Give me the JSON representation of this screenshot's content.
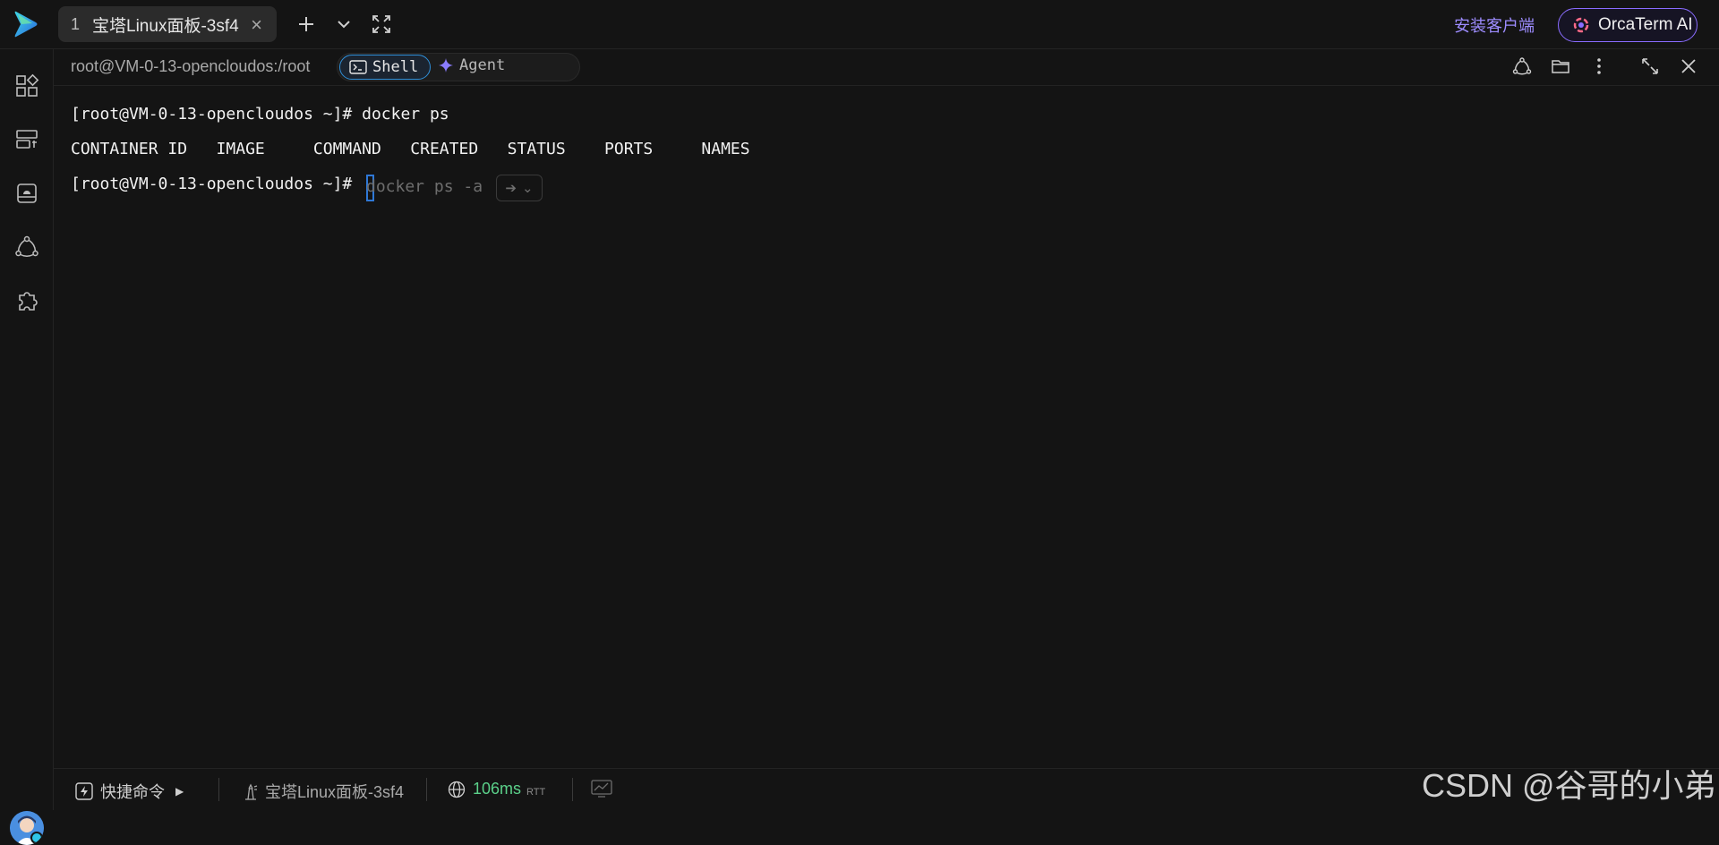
{
  "tabs": [
    {
      "index": "1",
      "title": "宝塔Linux面板-3sf4"
    }
  ],
  "header": {
    "install_label": "安装客户端",
    "ai_label": "OrcaTerm AI"
  },
  "session": {
    "path": "root@VM-0-13-opencloudos:/root",
    "mode_shell": "Shell",
    "mode_agent": "Agent"
  },
  "terminal": {
    "lines": [
      "[root@VM-0-13-opencloudos ~]# docker ps",
      "CONTAINER ID   IMAGE     COMMAND   CREATED   STATUS    PORTS     NAMES",
      "[root@VM-0-13-opencloudos ~]# "
    ],
    "suggestion": "docker ps -a",
    "accept_symbol": "➔",
    "accept_caret": "⌄"
  },
  "statusbar": {
    "quick_commands": "快捷命令",
    "server_name": "宝塔Linux面板-3sf4",
    "rtt_value": "106ms",
    "rtt_unit": "RTT"
  },
  "watermark": "CSDN @谷哥的小弟",
  "colors": {
    "background": "#141414",
    "accent_purple": "#9d8cff",
    "shell_blue": "#2f8fd8",
    "rtt_green": "#5bd18a"
  },
  "icons": {
    "top": [
      "app-logo-icon",
      "plus-icon",
      "chevron-down-icon",
      "fullscreen-icon"
    ],
    "sidebar": [
      "apps-grid-icon",
      "server-list-icon",
      "storage-icon",
      "share-network-icon",
      "plugin-icon"
    ],
    "header_right": [
      "share-network-icon",
      "folder-icon",
      "more-vertical-icon",
      "expand-icon",
      "close-icon"
    ]
  }
}
